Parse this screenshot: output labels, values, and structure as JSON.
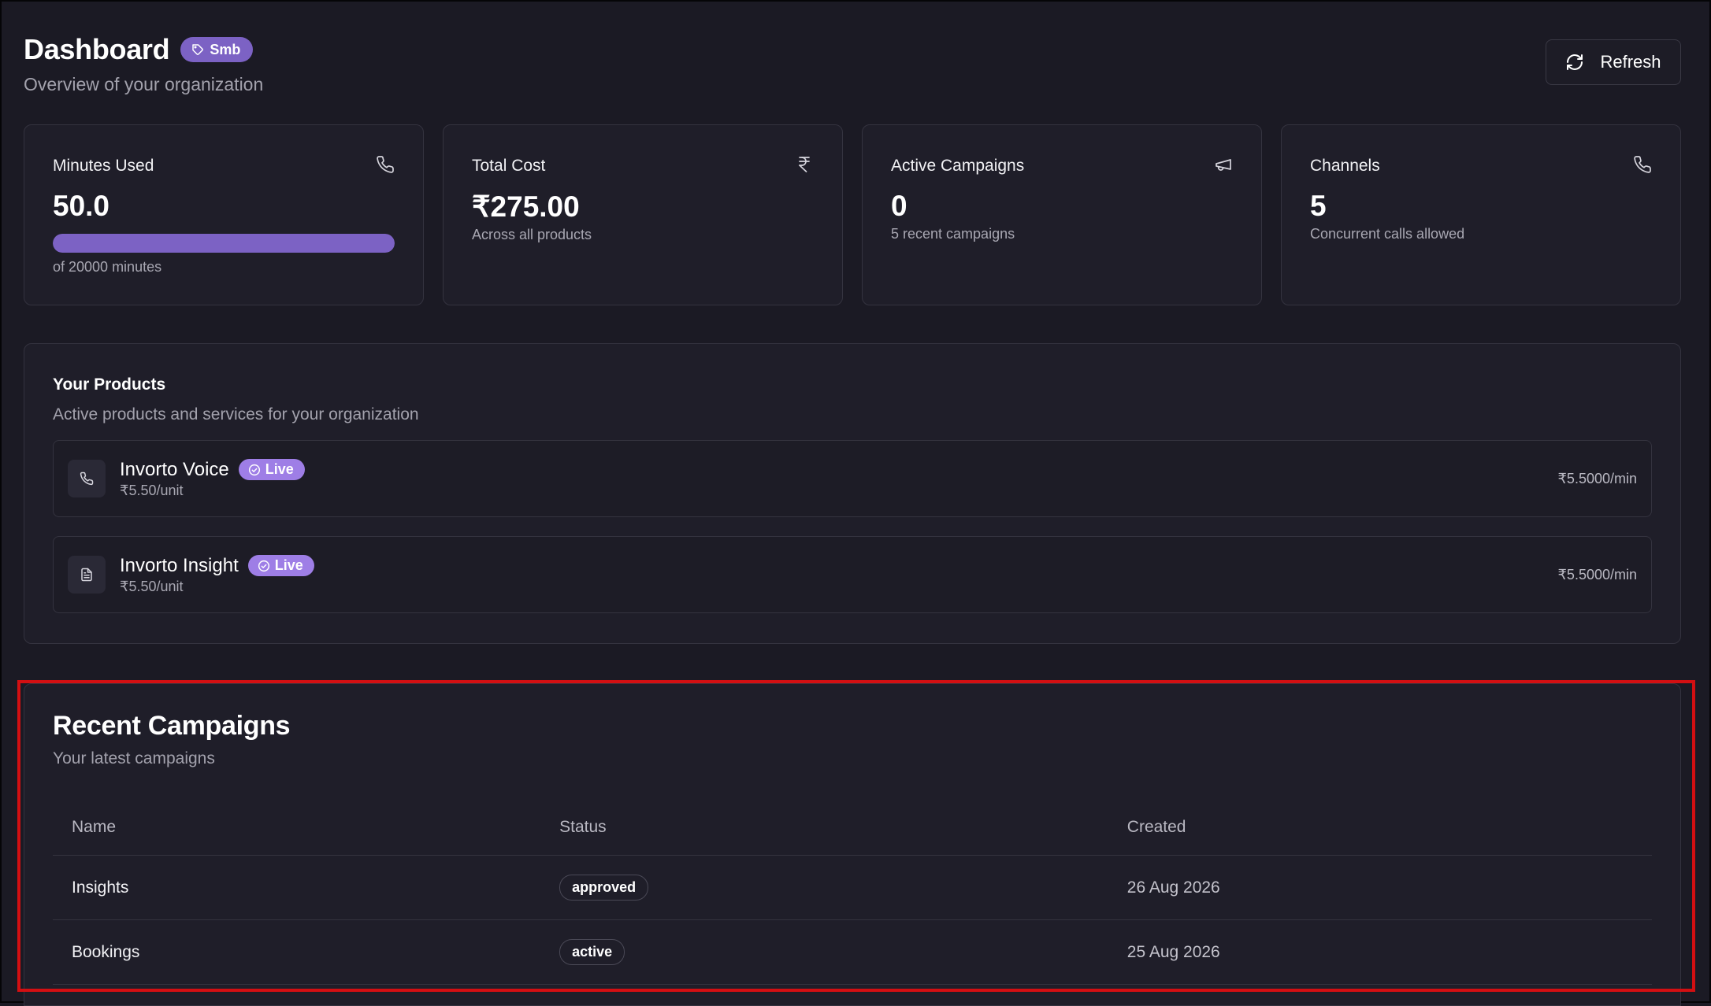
{
  "header": {
    "title": "Dashboard",
    "tier_badge": "Smb",
    "subtitle": "Overview of your organization",
    "refresh_label": "Refresh"
  },
  "stats": [
    {
      "label": "Minutes Used",
      "value": "50.0",
      "sub": "of 20000 minutes",
      "icon": "phone-icon",
      "progress_fraction": 1.0
    },
    {
      "label": "Total Cost",
      "value": "₹275.00",
      "sub": "Across all products",
      "icon": "rupee-icon"
    },
    {
      "label": "Active Campaigns",
      "value": "0",
      "sub": "5 recent campaigns",
      "icon": "megaphone-icon"
    },
    {
      "label": "Channels",
      "value": "5",
      "sub": "Concurrent calls allowed",
      "icon": "phone-icon"
    }
  ],
  "products": {
    "title": "Your Products",
    "subtitle": "Active products and services for your organization",
    "items": [
      {
        "name": "Invorto Voice",
        "status": "Live",
        "unit_price": "₹5.50/unit",
        "rate": "₹5.5000/min",
        "icon": "phone-icon"
      },
      {
        "name": "Invorto Insight",
        "status": "Live",
        "unit_price": "₹5.50/unit",
        "rate": "₹5.5000/min",
        "icon": "document-icon"
      }
    ]
  },
  "campaigns": {
    "title": "Recent Campaigns",
    "subtitle": "Your latest campaigns",
    "columns": [
      "Name",
      "Status",
      "Created"
    ],
    "rows": [
      {
        "name": "Insights",
        "status": "approved",
        "created": "26 Aug 2026"
      },
      {
        "name": "Bookings",
        "status": "active",
        "created": "25 Aug 2026"
      }
    ]
  },
  "colors": {
    "background": "#1b1a24",
    "card": "#1f1e29",
    "accent": "#7c62c4",
    "live_badge": "#9e7ee6",
    "highlight": "#d30f12"
  }
}
